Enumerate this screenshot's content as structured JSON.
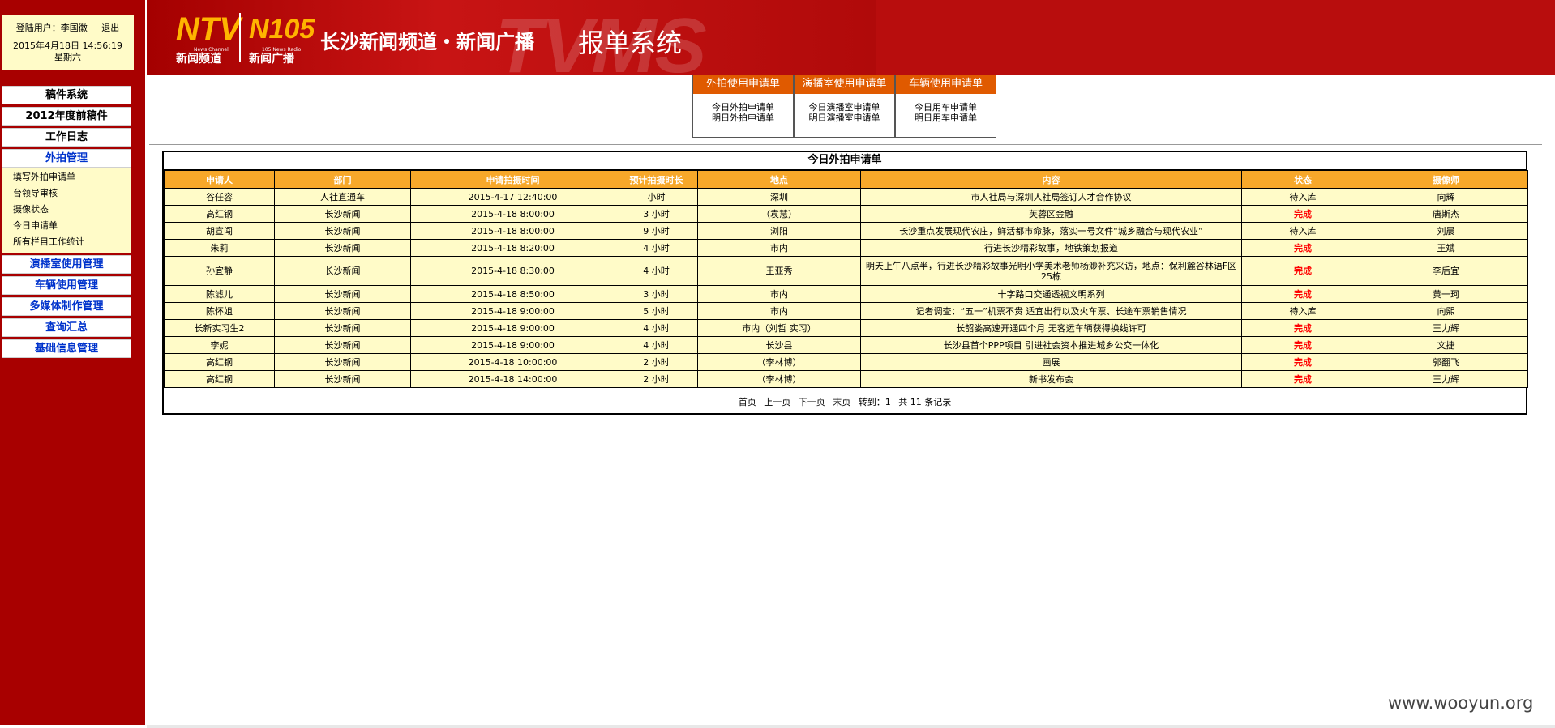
{
  "user": {
    "login_label": "登陆用户：李国徽",
    "logout": "退出",
    "datetime": "2015年4月18日  14:56:19",
    "weekday": "星期六"
  },
  "menu": {
    "item1": "稿件系统",
    "item2": "2012年度前稿件",
    "item3": "工作日志",
    "item4": "外拍管理",
    "sub": [
      "填写外拍申请单",
      "台领导审核",
      "摄像状态",
      "今日申请单",
      "所有栏目工作统计"
    ],
    "item5": "演播室使用管理",
    "item6": "车辆使用管理",
    "item7": "多媒体制作管理",
    "item8": "查询汇总",
    "item9": "基础信息管理"
  },
  "header": {
    "logo1_big": "NTV",
    "logo1_en": "News Channel",
    "logo1_cn": "新闻频道",
    "logo2_big": "N105",
    "logo2_en": "105 News Radio",
    "logo2_cn": "新闻广播",
    "title_main": "长沙新闻频道・新闻广播",
    "title_sys": "报单系统",
    "watermark_text": "TVMS"
  },
  "tabs": [
    {
      "title": "外拍使用申请单",
      "link1": "今日外拍申请单",
      "link2": "明日外拍申请单"
    },
    {
      "title": "演播室使用申请单",
      "link1": "今日演播室申请单",
      "link2": "明日演播室申请单"
    },
    {
      "title": "车辆使用申请单",
      "link1": "今日用车申请单",
      "link2": "明日用车申请单"
    }
  ],
  "table": {
    "title": "今日外拍申请单",
    "headers": [
      "申请人",
      "部门",
      "申请拍摄时间",
      "预计拍摄时长",
      "地点",
      "内容",
      "状态",
      "摄像师"
    ],
    "rows": [
      [
        "谷任容",
        "人社直通车",
        "2015-4-17 12:40:00",
        "小时",
        "深圳",
        "市人社局与深圳人社局签订人才合作协议",
        "待入库",
        "向辉"
      ],
      [
        "高红钢",
        "长沙新闻",
        "2015-4-18 8:00:00",
        "3 小时",
        "（袁慧）",
        "芙蓉区金融",
        "完成",
        "唐斯杰"
      ],
      [
        "胡宣闯",
        "长沙新闻",
        "2015-4-18 8:00:00",
        "9 小时",
        "浏阳",
        "长沙重点发展现代农庄，鲜活都市命脉，落实一号文件“城乡融合与现代农业”",
        "待入库",
        "刘晨"
      ],
      [
        "朱莉",
        "长沙新闻",
        "2015-4-18 8:20:00",
        "4 小时",
        "市内",
        "行进长沙精彩故事，地铁策划报道",
        "完成",
        "王斌"
      ],
      [
        "孙宜静",
        "长沙新闻",
        "2015-4-18 8:30:00",
        "4 小时",
        "王亚秀",
        "明天上午八点半，行进长沙精彩故事光明小学美术老师杨渺补充采访，地点：保利麓谷林语F区25栋",
        "完成",
        "李后宜"
      ],
      [
        "陈滤儿",
        "长沙新闻",
        "2015-4-18 8:50:00",
        "3 小时",
        "市内",
        "十字路口交通透视文明系列",
        "完成",
        "黄一珂"
      ],
      [
        "陈怀姐",
        "长沙新闻",
        "2015-4-18 9:00:00",
        "5 小时",
        "市内",
        "记者调查：“五一”机票不贵 适宜出行以及火车票、长途车票销售情况",
        "待入库",
        "向熙"
      ],
      [
        "长新实习生2",
        "长沙新闻",
        "2015-4-18 9:00:00",
        "4 小时",
        "市内（刘哲 实习）",
        "长韶娄高速开通四个月 无客运车辆获得换线许可",
        "完成",
        "王力辉"
      ],
      [
        "李妮",
        "长沙新闻",
        "2015-4-18 9:00:00",
        "4 小时",
        "长沙县",
        "长沙县首个PPP项目 引进社会资本推进城乡公交一体化",
        "完成",
        "文捷"
      ],
      [
        "高红钢",
        "长沙新闻",
        "2015-4-18 10:00:00",
        "2 小时",
        "（李林博）",
        "画展",
        "完成",
        "郭翻飞"
      ],
      [
        "高红钢",
        "长沙新闻",
        "2015-4-18 14:00:00",
        "2 小时",
        "（李林博）",
        "新书发布会",
        "完成",
        "王力辉"
      ]
    ]
  },
  "pager": {
    "first": "首页",
    "prev": "上一页",
    "next": "下一页",
    "last": "末页",
    "goto": "转到：1",
    "total": "共 11 条记录"
  },
  "watermark": "www.wooyun.org",
  "colors": {
    "sidebar": "#a80000",
    "header": "#b80d0d",
    "table_header": "#f7a82a",
    "row_bg": "#fffbc8",
    "tab_title": "#e05a00",
    "done_status": "#ff0000"
  }
}
